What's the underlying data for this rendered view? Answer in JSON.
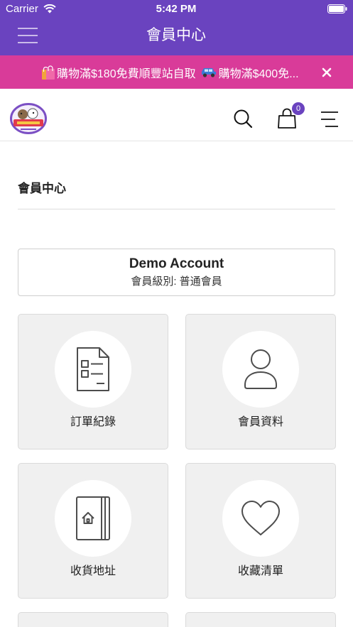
{
  "status_bar": {
    "carrier": "Carrier",
    "time": "5:42 PM",
    "wifi_icon": "wifi-icon",
    "battery_icon": "battery-icon"
  },
  "nav": {
    "title": "會員中心",
    "menu_icon": "hamburger-menu-icon"
  },
  "promo": {
    "items": [
      {
        "icon": "shopping-bags-icon",
        "text": "購物滿$180免費順豐站自取"
      },
      {
        "icon": "car-icon",
        "text": "購物滿$400免..."
      }
    ],
    "close_icon": "close-icon"
  },
  "header": {
    "logo_icon": "store-logo",
    "search_icon": "search-icon",
    "cart_icon": "shopping-bag-icon",
    "cart_count": "0",
    "menu_icon": "menu-icon"
  },
  "page": {
    "title": "會員中心"
  },
  "account": {
    "name": "Demo Account",
    "level": "會員級別: 普通會員"
  },
  "menu_cards": [
    {
      "label": "訂單紀錄",
      "icon": "order-list-icon"
    },
    {
      "label": "會員資料",
      "icon": "user-profile-icon"
    },
    {
      "label": "收貨地址",
      "icon": "address-book-icon"
    },
    {
      "label": "收藏清單",
      "icon": "heart-icon"
    }
  ],
  "colors": {
    "primary": "#6a43bf",
    "promo_banner": "#d93b99",
    "card_background": "#f0f0f0",
    "icon_stroke": "#4d4d4d"
  }
}
